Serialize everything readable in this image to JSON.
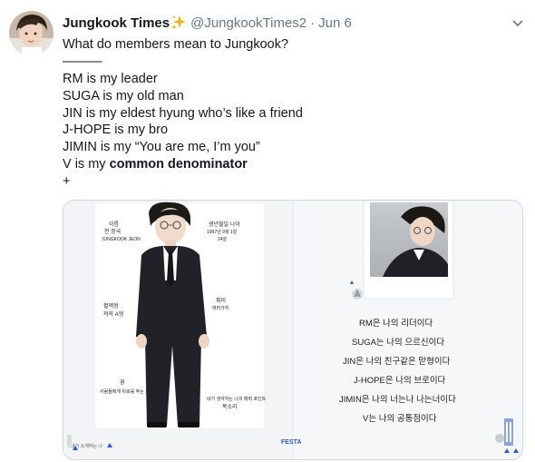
{
  "tweet": {
    "display_name": "Jungkook Times",
    "handle": "@JungkookTimes2",
    "separator": "·",
    "date": "Jun 6",
    "text_lines": [
      {
        "pre": "What do members mean to Jungkook?",
        "bold": ""
      },
      {
        "pre": "———",
        "bold": ""
      },
      {
        "pre": "RM is my leader",
        "bold": ""
      },
      {
        "pre": "SUGA is my old man",
        "bold": ""
      },
      {
        "pre": "JIN is my eldest hyung who’s like a friend",
        "bold": ""
      },
      {
        "pre": "J-HOPE is my bro",
        "bold": ""
      },
      {
        "pre": "JIMIN is my “You are me, I’m you”",
        "bold": ""
      },
      {
        "pre": "V is my ",
        "bold": "common denominator"
      },
      {
        "pre": "+",
        "bold": ""
      }
    ]
  },
  "media": {
    "left_page": {
      "name_label": "이름",
      "name_ko": "전 정국",
      "name_en": "JUNGKOOK JEON",
      "birthday_label": "생년월일 나이",
      "birthday_value": "1997년 9월 1일",
      "age_value": "24살",
      "blood_label": "혈액형",
      "blood_value": "저의 A형",
      "hobby_label": "취미",
      "hobby_value": "여러가지",
      "dream_label": "꿈",
      "dream_value": "사람들에게 위로를 주는 가수",
      "charm_label": "내가 생각하는 나의 매력 포인트",
      "charm_value": "목소리",
      "footer_note": "내가 소개하는 나"
    },
    "right_page": {
      "lines": [
        "RM은 나의 리더이다",
        "SUGA는 나의 으르신이다",
        "JIN은 나의 친구같은 맏형이다",
        "J-HOPE은 나의 브로이다",
        "JIMIN은 나의 너는나 나는너이다",
        "V는 나의 공통점이다"
      ]
    },
    "logo_text": "FESTA"
  },
  "colors": {
    "text": "#14171a",
    "secondary": "#657786",
    "media_border": "#ccd6dd",
    "sparkle": "#f4b400"
  }
}
